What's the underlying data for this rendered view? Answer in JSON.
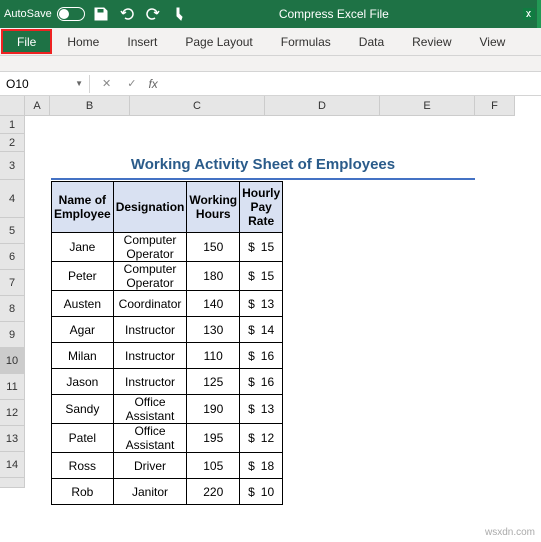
{
  "titlebar": {
    "autosave_label": "AutoSave",
    "doc_title": "Compress Excel File"
  },
  "ribbon": {
    "tabs": [
      "File",
      "Home",
      "Insert",
      "Page Layout",
      "Formulas",
      "Data",
      "Review",
      "View"
    ]
  },
  "namebox": {
    "ref": "O10",
    "fx": "fx"
  },
  "cols": [
    "A",
    "B",
    "C",
    "D",
    "E",
    "F"
  ],
  "rows": [
    "1",
    "2",
    "3",
    "4",
    "5",
    "6",
    "7",
    "8",
    "9",
    "10",
    "11",
    "12",
    "13",
    "14"
  ],
  "sheet_title": "Working Activity Sheet of Employees",
  "headers": {
    "name": "Name of Employee",
    "designation": "Designation",
    "hours": "Working Hours",
    "rate": "Hourly Pay Rate"
  },
  "currency": "$",
  "data": [
    {
      "name": "Jane",
      "designation": "Computer Operator",
      "hours": "150",
      "rate": "15"
    },
    {
      "name": "Peter",
      "designation": "Computer Operator",
      "hours": "180",
      "rate": "15"
    },
    {
      "name": "Austen",
      "designation": "Coordinator",
      "hours": "140",
      "rate": "13"
    },
    {
      "name": "Agar",
      "designation": "Instructor",
      "hours": "130",
      "rate": "14"
    },
    {
      "name": "Milan",
      "designation": "Instructor",
      "hours": "110",
      "rate": "16"
    },
    {
      "name": "Jason",
      "designation": "Instructor",
      "hours": "125",
      "rate": "16"
    },
    {
      "name": "Sandy",
      "designation": "Office Assistant",
      "hours": "190",
      "rate": "13"
    },
    {
      "name": "Patel",
      "designation": "Office Assistant",
      "hours": "195",
      "rate": "12"
    },
    {
      "name": "Ross",
      "designation": "Driver",
      "hours": "105",
      "rate": "18"
    },
    {
      "name": "Rob",
      "designation": "Janitor",
      "hours": "220",
      "rate": "10"
    }
  ],
  "watermark": "wsxdn.com"
}
